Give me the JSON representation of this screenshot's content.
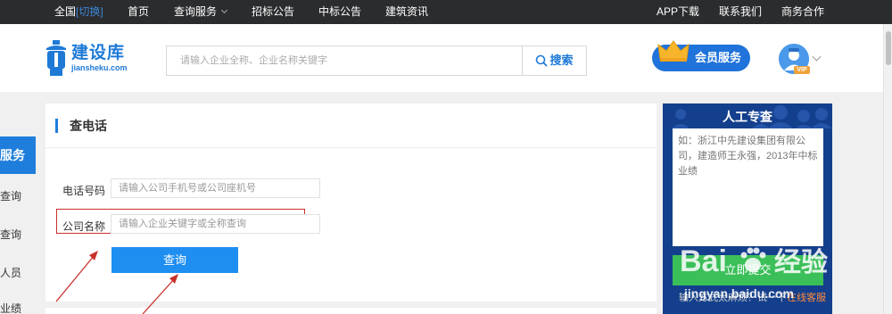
{
  "topnav": {
    "city": "全国",
    "switch": "[切换]",
    "items": [
      "首页",
      "查询服务",
      "招标公告",
      "中标公告",
      "建筑资讯"
    ],
    "right": [
      "APP下载",
      "联系我们",
      "商务合作"
    ]
  },
  "header": {
    "logo_title": "建设库",
    "logo_sub": "jiansheku.com",
    "search_placeholder": "请输入企业全称、企业名称关键字",
    "search_btn": "搜索",
    "member_btn": "会员服务",
    "vip": "VIP"
  },
  "sidemenu": {
    "active": "服务",
    "items": [
      "查询",
      "查询",
      "人员",
      "业绩"
    ]
  },
  "panel": {
    "title": "查电话",
    "phone_label": "电话号码",
    "phone_placeholder": "请输入公司手机号或公司座机号",
    "company_label": "公司名称",
    "company_placeholder": "请输入企业关键字或全称查询",
    "query_btn": "查询"
  },
  "card": {
    "title": "人工专查",
    "placeholder": "如：浙江中先建设集团有限公司，建造师王永强，2013年中标业绩",
    "submit": "立即提交",
    "foot_text": "输入方式太麻烦？试一下",
    "foot_link": "在线客服"
  },
  "watermark": {
    "text": "jingyan.baidu.com"
  },
  "colors": {
    "topbar": "#2b2c2e",
    "brand_blue": "#1f7ddb",
    "query_btn": "#1f8ef1",
    "highlight_red": "#c9302c",
    "card_bg": "#143f8c",
    "submit_green": "#3bbf59"
  }
}
